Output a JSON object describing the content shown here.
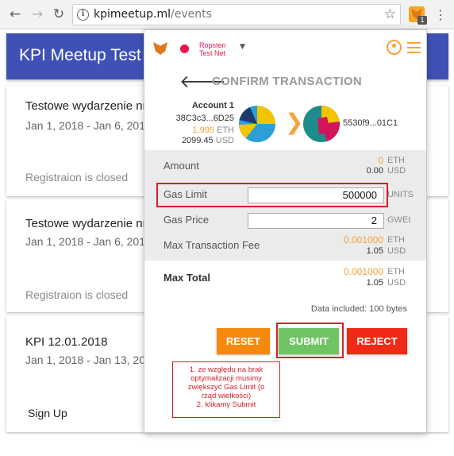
{
  "browser": {
    "url_host": "kpimeetup.ml",
    "url_path": "/events",
    "extension_badge": "1"
  },
  "site": {
    "title": "KPI Meetup Test",
    "events": [
      {
        "title": "Testowe wydarzenie nr",
        "dates": "Jan 1, 2018 - Jan 6, 201",
        "status": "Registraion is closed"
      },
      {
        "title": "Testowe wydarzenie nr",
        "dates": "Jan 1, 2018 - Jan 6, 201",
        "status": "Registraion is closed"
      },
      {
        "title": "KPI 12.01.2018",
        "dates": "Jan 1, 2018 - Jan 13, 20",
        "action": "Sign Up"
      }
    ]
  },
  "metamask": {
    "network": "Ropsten Test Net",
    "header_title": "CONFIRM TRANSACTION",
    "from": {
      "name": "Account 1",
      "address": "38C3c3...6D25",
      "eth": "1.995",
      "eth_unit": "ETH",
      "usd": "2099.45",
      "usd_unit": "USD"
    },
    "to": {
      "address": "5530f9...01C1"
    },
    "amount": {
      "label": "Amount",
      "eth": "0",
      "eth_unit": "ETH",
      "usd": "0.00",
      "usd_unit": "USD"
    },
    "gas_limit": {
      "label": "Gas Limit",
      "value": "500000",
      "unit": "UNITS"
    },
    "gas_price": {
      "label": "Gas Price",
      "value": "2",
      "unit": "GWEI"
    },
    "max_fee": {
      "label": "Max Transaction Fee",
      "eth": "0.001000",
      "eth_unit": "ETH",
      "usd": "1.05",
      "usd_unit": "USD"
    },
    "max_total": {
      "label": "Max Total",
      "eth": "0.001000",
      "eth_unit": "ETH",
      "usd": "1.05",
      "usd_unit": "USD"
    },
    "data_included": "Data included: 100 bytes",
    "buttons": {
      "reset": "RESET",
      "submit": "SUBMIT",
      "reject": "REJECT"
    }
  },
  "annotation": {
    "lines": [
      "1. ze względu na brak",
      "optymalizacji musimy",
      "zwiększyć Gas Limit (o",
      "rząd wielkości)",
      "2. klikamy Submit"
    ]
  },
  "colors": {
    "header_blue": "#3f51b5",
    "metamask_orange": "#f6a23d",
    "network_pink": "#e91550",
    "reset_orange": "#f5890e",
    "submit_green": "#6ec462",
    "reject_red": "#f02a16",
    "annotation_red": "#d61f27"
  },
  "icons": [
    "back-icon",
    "forward-icon",
    "reload-icon",
    "info-icon",
    "star-icon",
    "metamask-fox-icon",
    "menu-dots-icon",
    "account-icon",
    "hamburger-icon",
    "back-arrow-icon",
    "chevron-right-icon"
  ]
}
